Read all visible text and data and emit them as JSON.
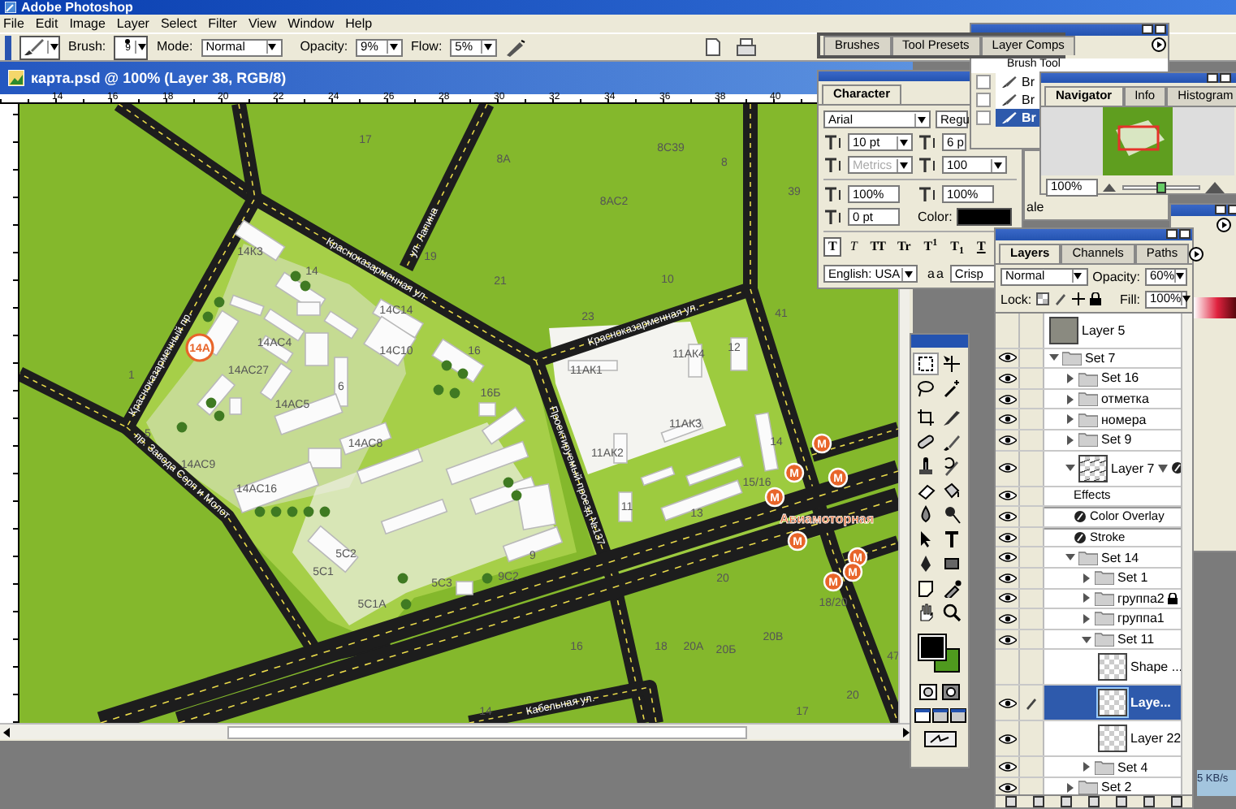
{
  "app": {
    "title": "Adobe Photoshop"
  },
  "menu": [
    "File",
    "Edit",
    "Image",
    "Layer",
    "Select",
    "Filter",
    "View",
    "Window",
    "Help"
  ],
  "options_bar": {
    "brush_label": "Brush:",
    "brush_size": "9",
    "mode_label": "Mode:",
    "mode": "Normal",
    "opacity_label": "Opacity:",
    "opacity": "9%",
    "flow_label": "Flow:",
    "flow": "5%"
  },
  "palette_well": [
    {
      "label": "Brushes"
    },
    {
      "label": "Tool Presets"
    },
    {
      "label": "Layer Comps"
    }
  ],
  "document": {
    "title": "карта.psd @ 100% (Layer 38, RGB/8)",
    "ruler": [
      "14",
      "16",
      "18",
      "20",
      "22",
      "24",
      "26",
      "28",
      "30",
      "32",
      "34",
      "36",
      "38",
      "40"
    ],
    "map": {
      "labels": [
        "17",
        "19",
        "8А",
        "8С39",
        "8",
        "8АС2",
        "39",
        "21",
        "10",
        "23",
        "41",
        "14К3",
        "14",
        "14С14",
        "14С10",
        "16",
        "14АС4",
        "14АС27",
        "1",
        "6",
        "14АС5",
        "16Б",
        "5",
        "14АС8",
        "14АС9",
        "14АС16",
        "11АК1",
        "11АК4",
        "12",
        "11АК3",
        "11АК2",
        "14",
        "15/16",
        "11",
        "13",
        "9",
        "9С2",
        "5С2",
        "5С1",
        "5С3",
        "5С1А",
        "20",
        "18/20",
        "16",
        "18",
        "20А",
        "20Б",
        "20В",
        "47",
        "20",
        "17",
        "14"
      ],
      "street_names": [
        "Красноказарменная ул.",
        "ул. Лапина",
        "Красноказарменная ул.",
        "Красноказарменный пр.",
        "пр. Завода Серп и Молот",
        "Проектируемый проезд №137",
        "Кабельная ул."
      ],
      "place_marker": "14А",
      "metro_markers": [
        "M",
        "M",
        "M",
        "M",
        "M",
        "M",
        "M",
        "M"
      ],
      "station_name": "Авиамоторная"
    }
  },
  "character": {
    "tab": "Character",
    "font": "Arial",
    "style": "Regu",
    "size": "10 pt",
    "leading": "6 p",
    "kerning": "Metrics",
    "kerning_disabled": true,
    "tracking": "100",
    "vertical_scale": "100%",
    "horizontal_scale": "100%",
    "baseline": "0 pt",
    "color_label": "Color:",
    "color": "#000000",
    "style_buttons": [
      {
        "label": "T",
        "selected": true
      },
      {
        "label": "T",
        "selected": false
      },
      {
        "label": "TT",
        "selected": false
      },
      {
        "label": "Tr",
        "selected": false
      },
      {
        "label": "T$^{1}$",
        "selected": false
      },
      {
        "label": "T$_{1}$",
        "selected": false
      },
      {
        "label": "T",
        "selected": false
      }
    ],
    "language": "English: USA",
    "antialias_icon": "aa",
    "antialias": "Crisp"
  },
  "brushes": {
    "header": "Brush Tool",
    "items": [
      {
        "label": "Br",
        "checked": false,
        "selected": false
      },
      {
        "label": "Br",
        "checked": false,
        "selected": false
      },
      {
        "label": "Br",
        "checked": false,
        "selected": true
      }
    ]
  },
  "navigator": {
    "tabs": [
      {
        "label": "Navigator",
        "selected": true
      },
      {
        "label": "Info",
        "selected": false
      },
      {
        "label": "Histogram",
        "selected": false
      }
    ],
    "zoom": "100%",
    "level": 0.5
  },
  "hidden_panel": {
    "text": "ale"
  },
  "layers": {
    "tabs": [
      {
        "label": "Layers",
        "selected": true
      },
      {
        "label": "Channels",
        "selected": false
      },
      {
        "label": "Paths",
        "selected": false
      }
    ],
    "blend": "Normal",
    "opacity_label": "Opacity:",
    "opacity": "60%",
    "lock_label": "Lock:",
    "fill_label": "Fill:",
    "fill": "100%",
    "items": [
      {
        "kind": "raster",
        "name": "Layer 5",
        "visible": false,
        "selected": false,
        "locked": false
      },
      {
        "kind": "set",
        "name": "Set 7",
        "visible": true,
        "selected": false,
        "locked": false,
        "expanded": true,
        "children": [
          {
            "kind": "set",
            "name": "Set 16",
            "visible": true,
            "selected": false,
            "locked": false,
            "expanded": false
          },
          {
            "kind": "set",
            "name": "отметка",
            "visible": true,
            "selected": false,
            "locked": false,
            "expanded": false
          },
          {
            "kind": "set",
            "name": "номера",
            "visible": true,
            "selected": false,
            "locked": false,
            "expanded": false
          },
          {
            "kind": "set",
            "name": "Set 9",
            "visible": true,
            "selected": false,
            "locked": false,
            "expanded": false
          },
          {
            "kind": "layer",
            "name": "Layer 7",
            "visible": true,
            "selected": false,
            "locked": false,
            "expanded": true,
            "children": [
              {
                "kind": "effects",
                "name": "Effects",
                "visible": true,
                "selected": false,
                "locked": false
              },
              {
                "kind": "effect",
                "name": "Color Overlay",
                "visible": true,
                "selected": false,
                "locked": false
              },
              {
                "kind": "effect",
                "name": "Stroke",
                "visible": true,
                "selected": false,
                "locked": false
              }
            ]
          },
          {
            "kind": "set",
            "name": "Set 14",
            "visible": true,
            "selected": false,
            "locked": false,
            "expanded": true,
            "children": [
              {
                "kind": "set",
                "name": "Set 1",
                "visible": true,
                "selected": false,
                "locked": false,
                "expanded": false
              },
              {
                "kind": "set",
                "name": "группа2",
                "visible": true,
                "selected": false,
                "locked": true,
                "expanded": false
              },
              {
                "kind": "set",
                "name": "группа1",
                "visible": true,
                "selected": false,
                "locked": false,
                "expanded": false
              },
              {
                "kind": "set",
                "name": "Set 11",
                "visible": true,
                "selected": false,
                "locked": false,
                "expanded": true,
                "children": [
                  {
                    "kind": "layer",
                    "name": "Shape ...",
                    "visible": false,
                    "selected": false,
                    "locked": false
                  },
                  {
                    "kind": "layer",
                    "name": "Laye...",
                    "visible": true,
                    "selected": true,
                    "locked": false
                  },
                  {
                    "kind": "layer",
                    "name": "Layer 22",
                    "visible": true,
                    "selected": false,
                    "locked": false
                  }
                ]
              },
              {
                "kind": "set",
                "name": "Set 4",
                "visible": true,
                "selected": false,
                "locked": false,
                "expanded": false
              }
            ]
          },
          {
            "kind": "set",
            "name": "Set 2",
            "visible": true,
            "selected": false,
            "locked": false,
            "expanded": false
          }
        ]
      }
    ]
  },
  "network_meter": "5 KB/s"
}
